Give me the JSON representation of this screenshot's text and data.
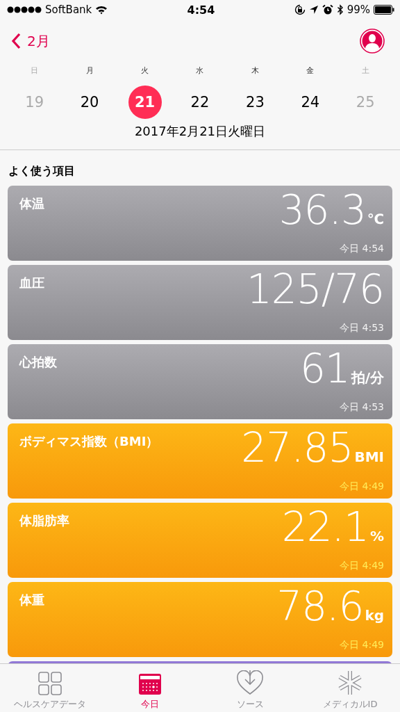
{
  "status_bar": {
    "carrier": "SoftBank",
    "time": "4:54",
    "battery": "99%"
  },
  "nav": {
    "back_label": "2月"
  },
  "week": [
    {
      "weekday": "日",
      "date": "19",
      "selected": false,
      "weekend": true
    },
    {
      "weekday": "月",
      "date": "20",
      "selected": false,
      "weekend": false
    },
    {
      "weekday": "火",
      "date": "21",
      "selected": true,
      "weekend": false
    },
    {
      "weekday": "水",
      "date": "22",
      "selected": false,
      "weekend": false
    },
    {
      "weekday": "木",
      "date": "23",
      "selected": false,
      "weekend": false
    },
    {
      "weekday": "金",
      "date": "24",
      "selected": false,
      "weekend": false
    },
    {
      "weekday": "土",
      "date": "25",
      "selected": false,
      "weekend": true
    }
  ],
  "full_date": "2017年2月21日火曜日",
  "section_title": "よく使う項目",
  "cards": [
    {
      "kind": "gray",
      "title": "体温",
      "value": "36.3",
      "unit": "℃",
      "time": "今日 4:54"
    },
    {
      "kind": "gray",
      "title": "血圧",
      "value": "125/76",
      "time": "今日 4:53"
    },
    {
      "kind": "gray",
      "title": "心拍数",
      "value": "61",
      "unit": "拍/分",
      "time": "今日 4:53"
    },
    {
      "kind": "orange",
      "title": "ボディマス指数（BMI）",
      "value": "27.85",
      "unit": "BMI",
      "time": "今日 4:49"
    },
    {
      "kind": "orange",
      "title": "体脂肪率",
      "value": "22.1",
      "unit": "%",
      "time": "今日 4:49"
    },
    {
      "kind": "orange",
      "title": "体重",
      "value": "78.6",
      "unit": "kg",
      "time": "今日 4:49"
    },
    {
      "kind": "purple"
    }
  ],
  "tab_bar": [
    {
      "label": "ヘルスケアデータ",
      "selected": false
    },
    {
      "label": "今日",
      "selected": true
    },
    {
      "label": "ソース",
      "selected": false
    },
    {
      "label": "メディカルID",
      "selected": false
    }
  ]
}
